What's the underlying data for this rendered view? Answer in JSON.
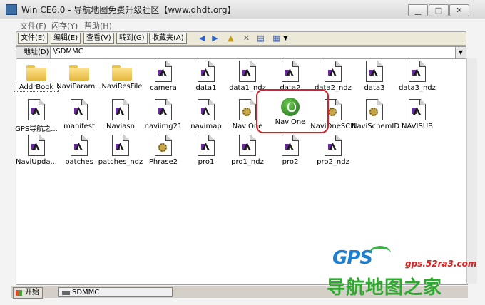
{
  "window": {
    "title": "Win CE6.0 - 导航地图免费升级社区【www.dhdt.org】",
    "buttons": {
      "minimize": "▁",
      "maximize": "□",
      "close": "✕"
    }
  },
  "menu": [
    "文件(F)",
    "闪存(Y)",
    "帮助(H)"
  ],
  "toolbar": {
    "items": [
      "文件(E)",
      "编辑(E)",
      "查看(V)",
      "转到(G)",
      "收藏夹(A)"
    ],
    "icons": [
      "back-icon",
      "forward-icon",
      "up-folder-icon",
      "delete-icon",
      "properties-icon",
      "views-icon"
    ]
  },
  "address": {
    "label": "地址(D)",
    "value": "\\SDMMC"
  },
  "files": [
    {
      "name": "AddrBook",
      "icon": "folder-icon"
    },
    {
      "name": "NaviParam...",
      "icon": "folder-icon"
    },
    {
      "name": "NaviResFile",
      "icon": "folder-icon"
    },
    {
      "name": "camera",
      "icon": "document-icon"
    },
    {
      "name": "data1",
      "icon": "document-icon"
    },
    {
      "name": "data1_ndz",
      "icon": "document-icon"
    },
    {
      "name": "data2",
      "icon": "document-icon"
    },
    {
      "name": "data2_ndz",
      "icon": "document-icon"
    },
    {
      "name": "data3",
      "icon": "document-icon"
    },
    {
      "name": "data3_ndz",
      "icon": "document-icon"
    },
    {
      "name": "GPS导航之...",
      "icon": "document-icon"
    },
    {
      "name": "manifest",
      "icon": "document-icon"
    },
    {
      "name": "Naviasn",
      "icon": "document-icon"
    },
    {
      "name": "naviimg21",
      "icon": "document-icon"
    },
    {
      "name": "navimap",
      "icon": "document-icon"
    },
    {
      "name": "NaviOne",
      "icon": "gear-document-icon"
    },
    {
      "name": "NaviOne",
      "icon": "navione-app-icon"
    },
    {
      "name": "NaviOneSCH",
      "icon": "gear-document-icon"
    },
    {
      "name": "NaviSchemID",
      "icon": "gear-document-icon"
    },
    {
      "name": "NAVISUB",
      "icon": "document-icon"
    },
    {
      "name": "NaviUpda...",
      "icon": "document-icon"
    },
    {
      "name": "patches",
      "icon": "document-icon"
    },
    {
      "name": "patches_ndz",
      "icon": "document-icon"
    },
    {
      "name": "Phrase2",
      "icon": "gear-document-icon"
    },
    {
      "name": "pro1",
      "icon": "document-icon"
    },
    {
      "name": "pro1_ndz",
      "icon": "document-icon"
    },
    {
      "name": "pro2",
      "icon": "document-icon"
    },
    {
      "name": "pro2_ndz",
      "icon": "document-icon"
    }
  ],
  "taskbar": {
    "start": "开始",
    "task": "SDMMC"
  },
  "watermark": {
    "logo": "GPS",
    "url": "gps.52ra3.com",
    "cn": "导航地图之家"
  },
  "colors": {
    "highlight": "#d4232a",
    "watermark_green": "#2ea82f",
    "watermark_blue": "#1e7fd0"
  }
}
